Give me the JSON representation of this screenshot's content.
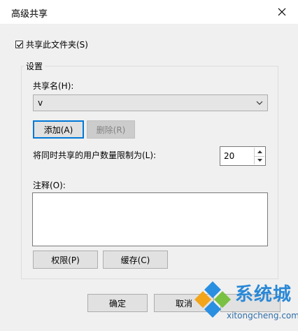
{
  "window": {
    "title": "高级共享"
  },
  "share_checkbox": {
    "label": "共享此文件夹(S)",
    "checked": true
  },
  "settings": {
    "group_label": "设置",
    "share_name_label": "共享名(H):",
    "share_name_value": "v",
    "add_button": "添加(A)",
    "remove_button": "删除(R)",
    "user_limit_label": "将同时共享的用户数量限制为(L):",
    "user_limit_value": "20",
    "comment_label": "注释(O):",
    "comment_value": "",
    "permissions_button": "权限(P)",
    "caching_button": "缓存(C)"
  },
  "footer": {
    "ok_button": "确定",
    "cancel_button": "取消"
  },
  "watermark": {
    "brand": "系统城",
    "url": "xitongcheng.com"
  },
  "colors": {
    "accent": "#0078d7",
    "client_bg": "#f0f0f0"
  },
  "icons": {
    "close": "close-icon",
    "check": "check-icon",
    "dropdown": "chevron-down-icon"
  }
}
